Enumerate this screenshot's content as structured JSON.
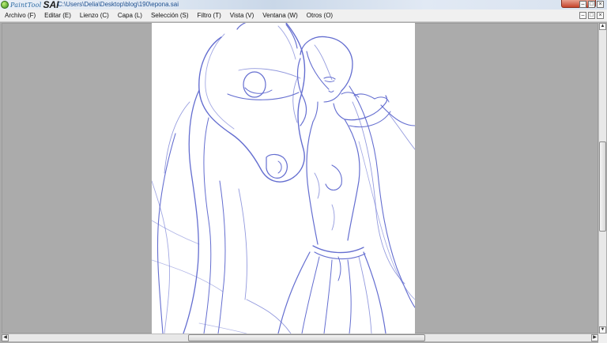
{
  "window": {
    "logo_text": "PaintTool",
    "logo_sai": "SAI",
    "title": "C:\\Users\\Delia\\Desktop\\blog\\190\\epona.sai",
    "buttons": [
      "–",
      "□",
      "×"
    ]
  },
  "menu": {
    "items": [
      {
        "label": "Archivo (F)"
      },
      {
        "label": "Editar (E)"
      },
      {
        "label": "Lienzo (C)"
      },
      {
        "label": "Capa (L)"
      },
      {
        "label": "Selección (S)"
      },
      {
        "label": "Filtro (T)"
      },
      {
        "label": "Vista (V)"
      },
      {
        "label": "Ventana (W)"
      },
      {
        "label": "Otros (O)"
      }
    ],
    "doc_buttons": [
      "–",
      "□",
      "×"
    ]
  },
  "scrollbars": {
    "up": "▲",
    "down": "▼",
    "left": "◀",
    "right": "▶"
  },
  "colors": {
    "sketch_line": "#4a55c8",
    "workspace_bg": "#ababab",
    "canvas_bg": "#ffffff"
  }
}
